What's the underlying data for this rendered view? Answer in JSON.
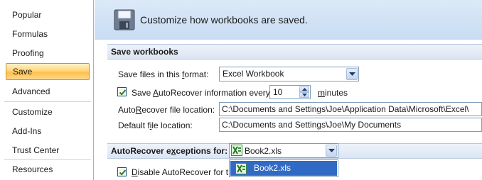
{
  "sidebar": {
    "items": [
      {
        "label": "Popular"
      },
      {
        "label": "Formulas"
      },
      {
        "label": "Proofing"
      },
      {
        "label": "Save"
      },
      {
        "label": "Advanced"
      },
      {
        "label": "Customize"
      },
      {
        "label": "Add-Ins"
      },
      {
        "label": "Trust Center"
      },
      {
        "label": "Resources"
      }
    ],
    "active": "Save"
  },
  "header": {
    "title": "Customize how workbooks are saved.",
    "icon": "floppy-disk-icon"
  },
  "save_workbooks": {
    "section_title": "Save workbooks",
    "format_label_pre": "Save files in this ",
    "format_label_ul": "f",
    "format_label_post": "ormat:",
    "format_value": "Excel Workbook",
    "autorecover_checked": true,
    "autorecover_label_pre": "Save ",
    "autorecover_label_ul": "A",
    "autorecover_label_post": "utoRecover information every",
    "autorecover_minutes": "10",
    "minutes_ul": "m",
    "minutes_post": "inutes",
    "location_label_pre": "Auto",
    "location_label_ul": "R",
    "location_label_post": "ecover file location:",
    "location_value": "C:\\Documents and Settings\\Joe\\Application Data\\Microsoft\\Excel\\",
    "default_label_pre": "Default f",
    "default_label_ul": "i",
    "default_label_post": "le location:",
    "default_value": "C:\\Documents and Settings\\Joe\\My Documents"
  },
  "exceptions": {
    "section_title_pre": "AutoRecover e",
    "section_title_ul": "x",
    "section_title_post": "ceptions for:",
    "selected_workbook": "Book2.xls",
    "options": [
      "Book2.xls"
    ],
    "disable_checked": true,
    "disable_label_pre": "D",
    "disable_label_post": "isable AutoRecover for th"
  },
  "colors": {
    "accent_active": "#ffbf47",
    "selection": "#316ac5",
    "header_band": "#c9dcf3"
  }
}
